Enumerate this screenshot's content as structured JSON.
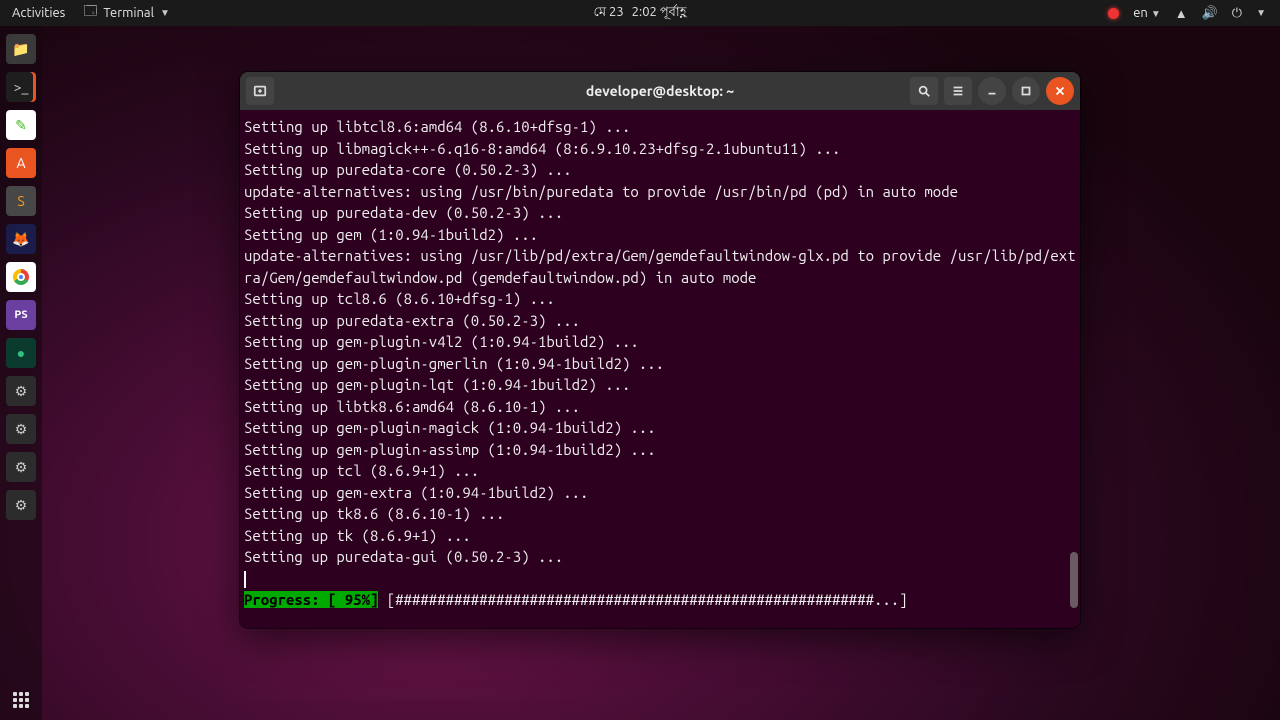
{
  "topbar": {
    "activities": "Activities",
    "app_icon": "terminal-icon",
    "app_name": "Terminal",
    "date": "মে 23",
    "time": "2:02 পূর্বাহ্ণ",
    "lang": "en"
  },
  "dock": {
    "items": [
      {
        "name": "files",
        "icon": "📁"
      },
      {
        "name": "terminal",
        "icon": ">_",
        "active": true
      },
      {
        "name": "gedit",
        "icon": "✎"
      },
      {
        "name": "software",
        "icon": "A"
      },
      {
        "name": "sublime",
        "icon": "S"
      },
      {
        "name": "firefox",
        "icon": "🦊"
      },
      {
        "name": "chrome",
        "icon": "chrome"
      },
      {
        "name": "phpstorm",
        "icon": "PS"
      },
      {
        "name": "greenapp",
        "icon": "●"
      },
      {
        "name": "settings1",
        "icon": "⚙"
      },
      {
        "name": "settings2",
        "icon": "⚙"
      },
      {
        "name": "settings3",
        "icon": "⚙"
      },
      {
        "name": "settings4",
        "icon": "⚙"
      }
    ]
  },
  "window": {
    "title": "developer@desktop: ~"
  },
  "terminal": {
    "lines": [
      "Setting up libtcl8.6:amd64 (8.6.10+dfsg-1) ...",
      "Setting up libmagick++-6.q16-8:amd64 (8:6.9.10.23+dfsg-2.1ubuntu11) ...",
      "Setting up puredata-core (0.50.2-3) ...",
      "update-alternatives: using /usr/bin/puredata to provide /usr/bin/pd (pd) in auto mode",
      "Setting up puredata-dev (0.50.2-3) ...",
      "Setting up gem (1:0.94-1build2) ...",
      "update-alternatives: using /usr/lib/pd/extra/Gem/gemdefaultwindow-glx.pd to provide /usr/lib/pd/extra/Gem/gemdefaultwindow.pd (gemdefaultwindow.pd) in auto mode",
      "Setting up tcl8.6 (8.6.10+dfsg-1) ...",
      "Setting up puredata-extra (0.50.2-3) ...",
      "Setting up gem-plugin-v4l2 (1:0.94-1build2) ...",
      "Setting up gem-plugin-gmerlin (1:0.94-1build2) ...",
      "Setting up gem-plugin-lqt (1:0.94-1build2) ...",
      "Setting up libtk8.6:amd64 (8.6.10-1) ...",
      "Setting up gem-plugin-magick (1:0.94-1build2) ...",
      "Setting up gem-plugin-assimp (1:0.94-1build2) ...",
      "Setting up tcl (8.6.9+1) ...",
      "Setting up gem-extra (1:0.94-1build2) ...",
      "Setting up tk8.6 (8.6.10-1) ...",
      "Setting up tk (8.6.9+1) ...",
      "Setting up puredata-gui (0.50.2-3) ..."
    ],
    "progress": {
      "label": "Progress: [ 95%]",
      "bar": " [#########################################################...] "
    }
  }
}
